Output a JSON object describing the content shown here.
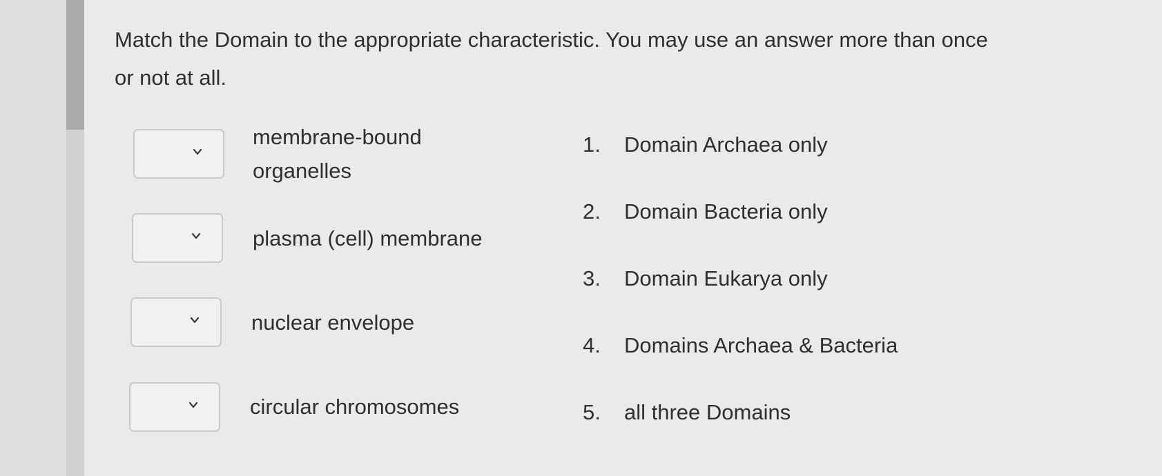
{
  "question": {
    "text": "Match the Domain to the appropriate characteristic. You may use an answer more than once or not at all."
  },
  "items": [
    {
      "label_line1": "membrane-bound",
      "label_line2": "organelles",
      "selected": ""
    },
    {
      "label": "plasma (cell) membrane",
      "selected": ""
    },
    {
      "label": "nuclear envelope",
      "selected": ""
    },
    {
      "label": "circular chromosomes",
      "selected": ""
    }
  ],
  "options": [
    {
      "number": "1.",
      "text": "Domain Archaea only"
    },
    {
      "number": "2.",
      "text": "Domain Bacteria only"
    },
    {
      "number": "3.",
      "text": "Domain Eukarya only"
    },
    {
      "number": "4.",
      "text": "Domains Archaea & Bacteria"
    },
    {
      "number": "5.",
      "text": "all three Domains"
    }
  ]
}
